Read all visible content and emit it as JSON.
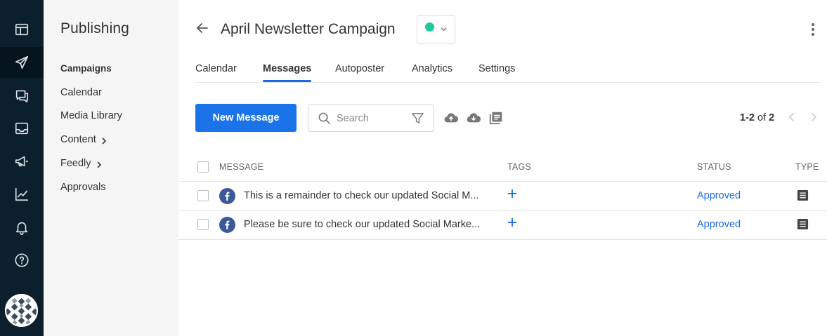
{
  "rail": {
    "items": [
      {
        "name": "dashboard-icon"
      },
      {
        "name": "publishing-send-icon"
      },
      {
        "name": "conversations-icon"
      },
      {
        "name": "inbox-icon"
      },
      {
        "name": "megaphone-icon"
      },
      {
        "name": "analytics-icon"
      },
      {
        "name": "notifications-bell-icon"
      },
      {
        "name": "help-icon"
      }
    ],
    "active_index": 1
  },
  "subnav": {
    "title": "Publishing",
    "items": [
      {
        "label": "Campaigns",
        "active": true,
        "chevron": false
      },
      {
        "label": "Calendar",
        "active": false,
        "chevron": false
      },
      {
        "label": "Media Library",
        "active": false,
        "chevron": false
      },
      {
        "label": "Content",
        "active": false,
        "chevron": true
      },
      {
        "label": "Feedly",
        "active": false,
        "chevron": true
      },
      {
        "label": "Approvals",
        "active": false,
        "chevron": false
      }
    ]
  },
  "header": {
    "title": "April Newsletter Campaign",
    "status_color": "#1ec9a0"
  },
  "tabs": [
    {
      "label": "Calendar",
      "active": false
    },
    {
      "label": "Messages",
      "active": true
    },
    {
      "label": "Autoposter",
      "active": false
    },
    {
      "label": "Analytics",
      "active": false
    },
    {
      "label": "Settings",
      "active": false
    }
  ],
  "toolbar": {
    "new_message_label": "New Message",
    "search_placeholder": "Search",
    "tools": [
      "upload-cloud-icon",
      "download-cloud-icon",
      "library-icon"
    ]
  },
  "pagination": {
    "range": "1-2",
    "of_label": "of",
    "total": "2"
  },
  "table": {
    "columns": {
      "message": "MESSAGE",
      "tags": "TAGS",
      "status": "STATUS",
      "type": "TYPE"
    },
    "rows": [
      {
        "network": "facebook",
        "message": "This is a remainder to check our updated Social M...",
        "status": "Approved",
        "type": "text"
      },
      {
        "network": "facebook",
        "message": "Please be sure to check our updated Social Marke...",
        "status": "Approved",
        "type": "text"
      }
    ]
  },
  "colors": {
    "rail_bg": "#0c1f2c",
    "accent": "#1a73e8",
    "link": "#1a6ae6",
    "facebook": "#3b5998"
  }
}
